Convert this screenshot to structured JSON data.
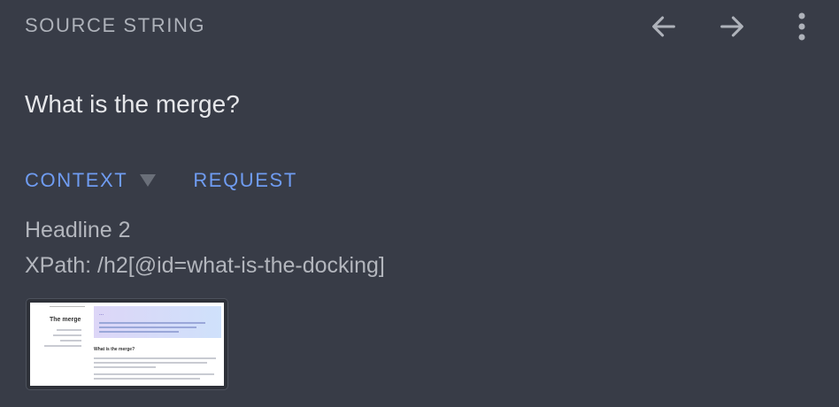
{
  "header": {
    "title": "SOURCE STRING",
    "icons": [
      "arrow-left-icon",
      "arrow-right-icon",
      "more-vert-icon"
    ]
  },
  "source": {
    "text": "What is the merge?"
  },
  "tabs": [
    {
      "label": "CONTEXT"
    },
    {
      "label": "REQUEST"
    }
  ],
  "context": {
    "tag": "Headline 2",
    "xpath": "XPath: /h2[@id=what-is-the-docking]"
  },
  "screenshot": {
    "sidebar_title": "The merge",
    "banner_title": "...",
    "section_heading": "What is the merge?"
  },
  "colors": {
    "background": "#383c47",
    "accent": "#6f9cf2",
    "text": "#e6e7ea",
    "muted": "#aeb2ba"
  }
}
